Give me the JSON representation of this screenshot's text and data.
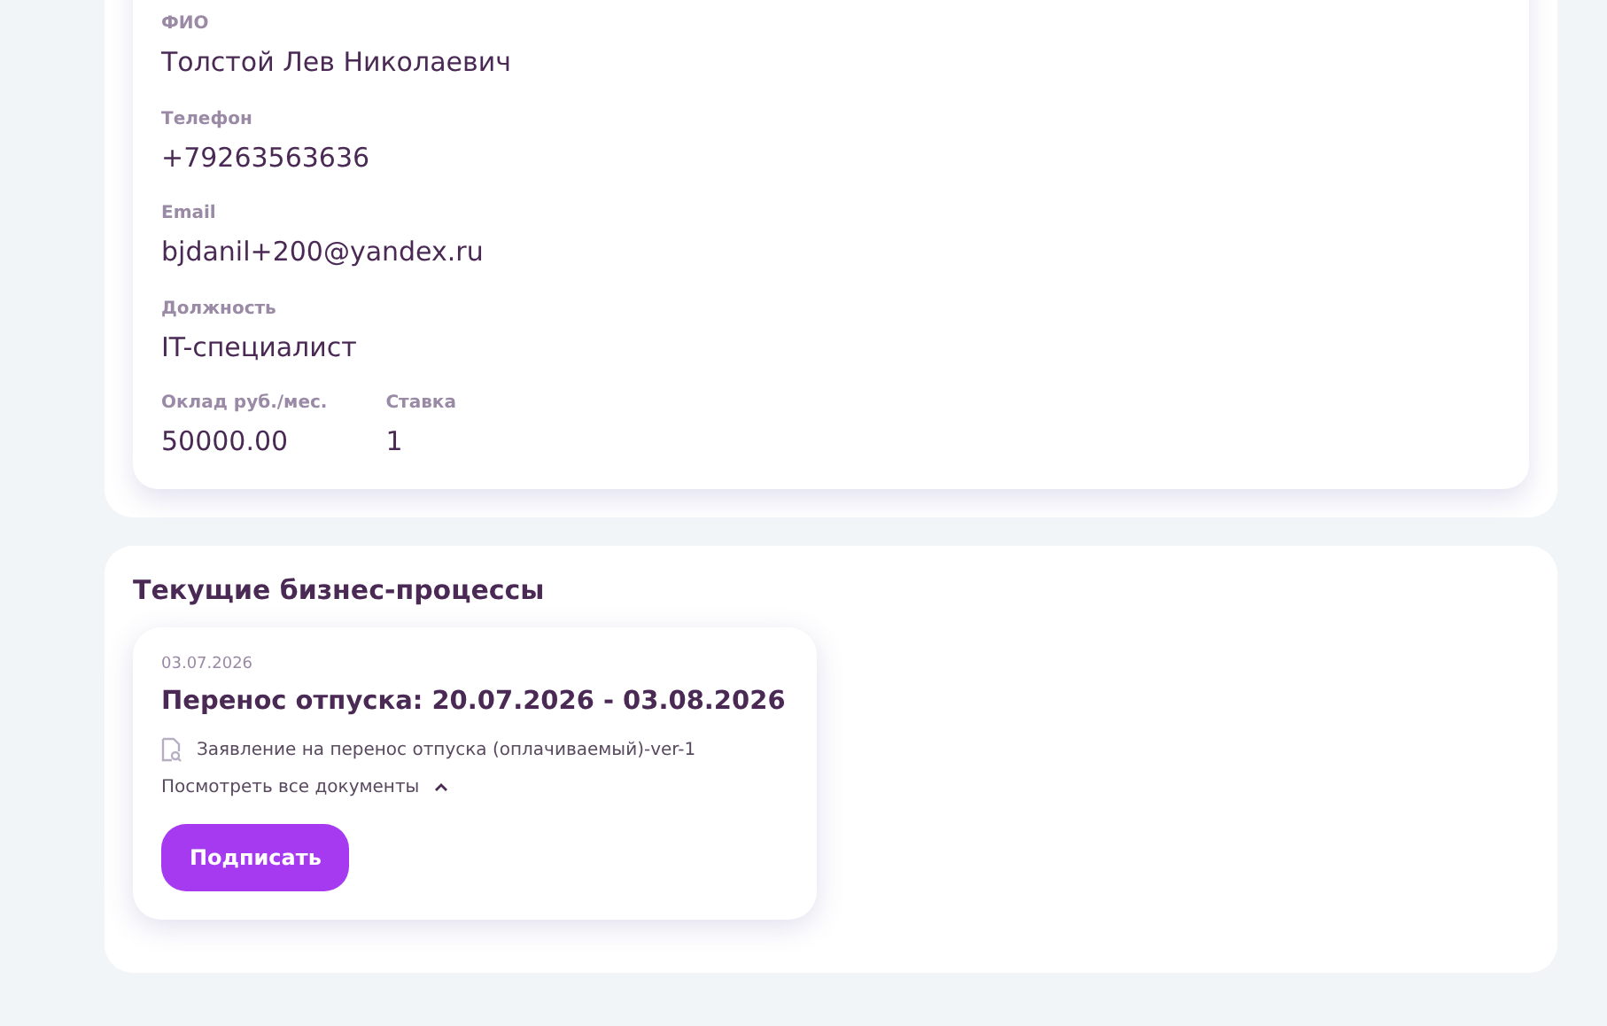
{
  "profile": {
    "fields": [
      {
        "label": "ФИО",
        "value": "Толстой Лев Николаевич"
      },
      {
        "label": "Телефон",
        "value": "+79263563636"
      },
      {
        "label": "Email",
        "value": "bjdanil+200@yandex.ru"
      },
      {
        "label": "Должность",
        "value": "IT-специалист"
      }
    ],
    "pair": [
      {
        "label": "Оклад руб./мес.",
        "value": "50000.00"
      },
      {
        "label": "Ставка",
        "value": "1"
      }
    ]
  },
  "processes": {
    "title": "Текущие бизнес-процессы",
    "items": [
      {
        "date": "03.07.2026",
        "title": "Перенос отпуска: 20.07.2026 - 03.08.2026",
        "documents": [
          "Заявление на перенос отпуска (оплачиваемый)-ver-1"
        ],
        "toggle": "Посмотреть все документы",
        "expanded": true,
        "action": "Подписать"
      }
    ]
  }
}
